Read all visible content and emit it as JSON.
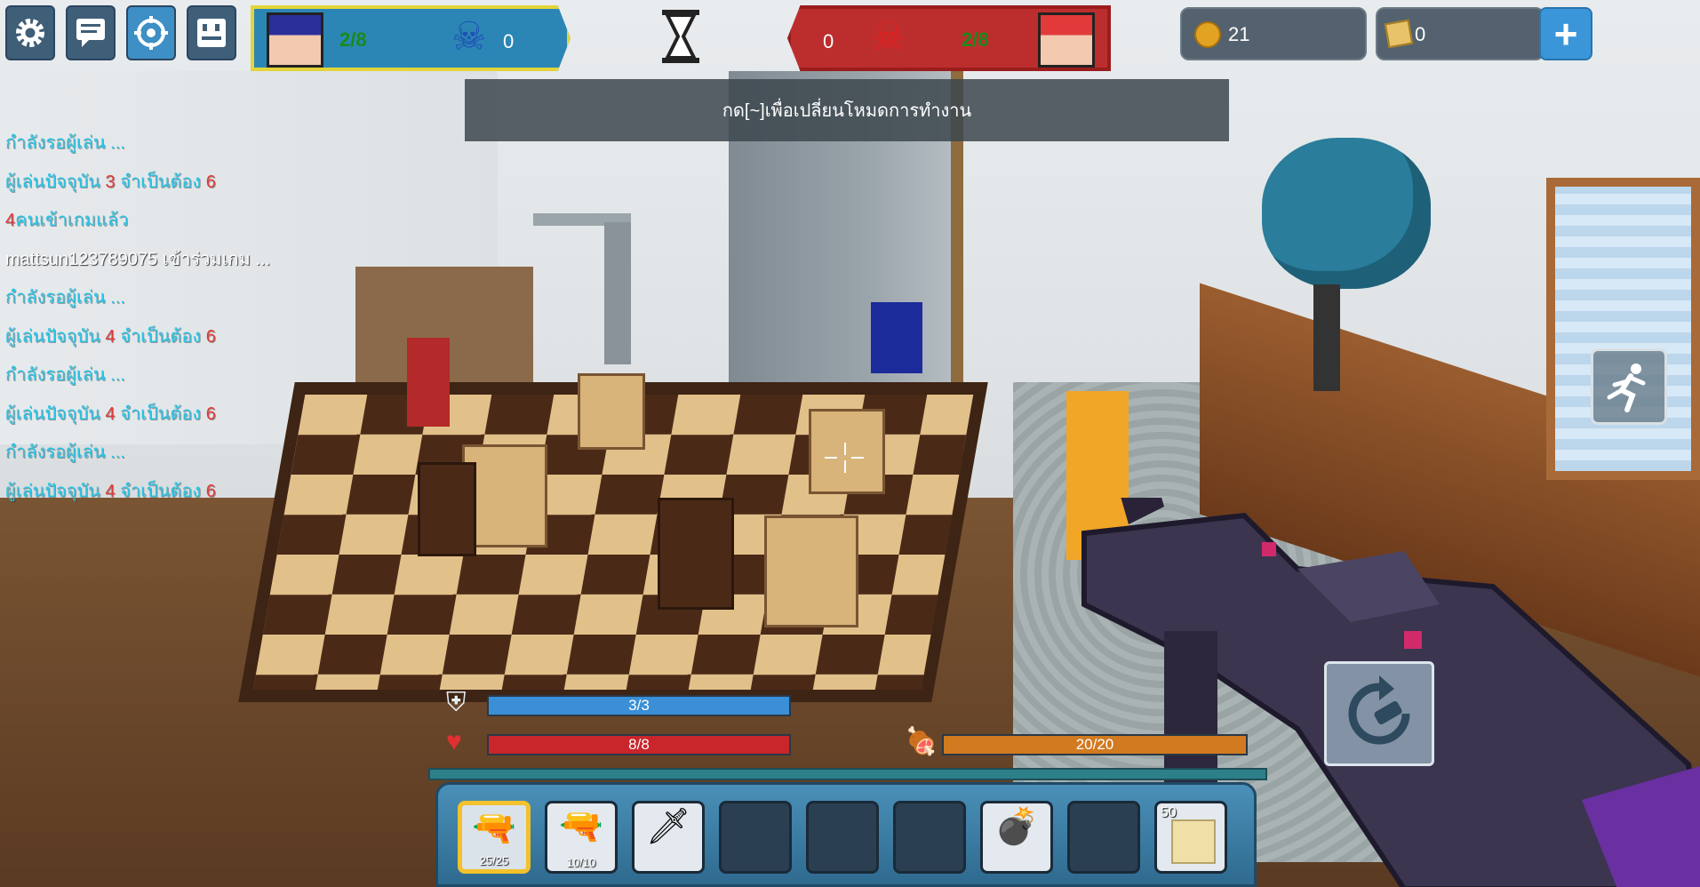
{
  "hud": {
    "menu_buttons": [
      {
        "icon": "gear-icon"
      },
      {
        "icon": "chat-icon"
      },
      {
        "icon": "target-icon"
      },
      {
        "icon": "scoreboard-icon"
      }
    ],
    "blue_team": {
      "score": "2/8",
      "kills": "0",
      "color": "#2c86b5"
    },
    "red_team": {
      "score": "2/8",
      "kills": "0",
      "color": "#bc2e2e"
    },
    "timer_icon": "hourglass-icon",
    "coins": "21",
    "gems": "0",
    "add_currency_icon": "plus-icon",
    "notice": "กด[~]เพื่อเปลี่ยนโหมดการทำงาน"
  },
  "chat": [
    {
      "parts": [
        {
          "text": "กำลังรอผู้เล่น ...",
          "color": "cyan"
        }
      ]
    },
    {
      "parts": [
        {
          "text": "ผู้เล่นปัจจุบัน ",
          "color": "cyan"
        },
        {
          "text": "3",
          "color": "red"
        },
        {
          "text": "  จำเป็นต้อง  ",
          "color": "cyan"
        },
        {
          "text": "6",
          "color": "red"
        }
      ]
    },
    {
      "parts": [
        {
          "text": "4",
          "color": "red"
        },
        {
          "text": "คนเข้าเกมแล้ว",
          "color": "cyan"
        }
      ]
    },
    {
      "parts": [
        {
          "text": "mattsun123789075 เข้าร่วมเกม ...",
          "color": "white"
        }
      ]
    },
    {
      "parts": [
        {
          "text": "กำลังรอผู้เล่น ...",
          "color": "cyan"
        }
      ]
    },
    {
      "parts": [
        {
          "text": "ผู้เล่นปัจจุบัน ",
          "color": "cyan"
        },
        {
          "text": "4",
          "color": "red"
        },
        {
          "text": "  จำเป็นต้อง  ",
          "color": "cyan"
        },
        {
          "text": "6",
          "color": "red"
        }
      ]
    },
    {
      "parts": [
        {
          "text": "กำลังรอผู้เล่น ...",
          "color": "cyan"
        }
      ]
    },
    {
      "parts": [
        {
          "text": "ผู้เล่นปัจจุบัน ",
          "color": "cyan"
        },
        {
          "text": "4",
          "color": "red"
        },
        {
          "text": "  จำเป็นต้อง  ",
          "color": "cyan"
        },
        {
          "text": "6",
          "color": "red"
        }
      ]
    },
    {
      "parts": [
        {
          "text": "กำลังรอผู้เล่น ...",
          "color": "cyan"
        }
      ]
    },
    {
      "parts": [
        {
          "text": "ผู้เล่นปัจจุบัน ",
          "color": "cyan"
        },
        {
          "text": "4",
          "color": "red"
        },
        {
          "text": "  จำเป็นต้อง  ",
          "color": "cyan"
        },
        {
          "text": "6",
          "color": "red"
        }
      ]
    }
  ],
  "stats": {
    "armor": {
      "label": "3/3",
      "fraction": 1.0,
      "color": "#3a8fd6",
      "icon": "armor-icon"
    },
    "health": {
      "label": "8/8",
      "fraction": 1.0,
      "color": "#c8262b",
      "icon": "heart-icon"
    },
    "food": {
      "label": "20/20",
      "fraction": 1.0,
      "color": "#d17a1f",
      "icon": "meat-icon"
    }
  },
  "hotbar": [
    {
      "icon": "rifle-icon",
      "ammo": "25/25",
      "selected": true
    },
    {
      "icon": "blaster-icon",
      "ammo": "10/10"
    },
    {
      "icon": "sword-icon",
      "ammo": ""
    },
    {
      "icon": "empty-slot"
    },
    {
      "icon": "empty-slot"
    },
    {
      "icon": "empty-slot"
    },
    {
      "icon": "grenade-icon",
      "ammo": ""
    },
    {
      "icon": "empty-slot"
    },
    {
      "icon": "block-icon",
      "count": "50"
    }
  ],
  "buttons": {
    "run_icon": "running-man-icon",
    "reload_icon": "reload-icon"
  }
}
